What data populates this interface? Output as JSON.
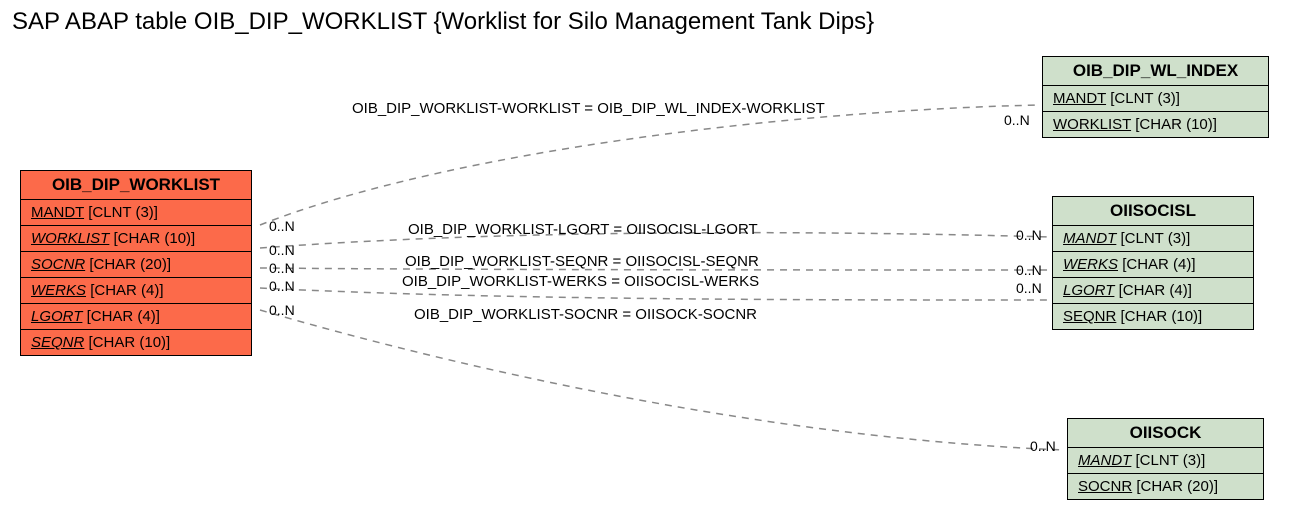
{
  "title": "SAP ABAP table OIB_DIP_WORKLIST {Worklist for Silo Management Tank Dips}",
  "entities": {
    "main": {
      "name": "OIB_DIP_WORKLIST",
      "fields": [
        {
          "name": "MANDT",
          "type": "[CLNT (3)]",
          "key": false
        },
        {
          "name": "WORKLIST",
          "type": "[CHAR (10)]",
          "key": true
        },
        {
          "name": "SOCNR",
          "type": "[CHAR (20)]",
          "key": true
        },
        {
          "name": "WERKS",
          "type": "[CHAR (4)]",
          "key": true
        },
        {
          "name": "LGORT",
          "type": "[CHAR (4)]",
          "key": true
        },
        {
          "name": "SEQNR",
          "type": "[CHAR (10)]",
          "key": true
        }
      ]
    },
    "wlindex": {
      "name": "OIB_DIP_WL_INDEX",
      "fields": [
        {
          "name": "MANDT",
          "type": "[CLNT (3)]",
          "key": false
        },
        {
          "name": "WORKLIST",
          "type": "[CHAR (10)]",
          "key": false
        }
      ]
    },
    "oiisocisl": {
      "name": "OIISOCISL",
      "fields": [
        {
          "name": "MANDT",
          "type": "[CLNT (3)]",
          "key": true
        },
        {
          "name": "WERKS",
          "type": "[CHAR (4)]",
          "key": true
        },
        {
          "name": "LGORT",
          "type": "[CHAR (4)]",
          "key": true
        },
        {
          "name": "SEQNR",
          "type": "[CHAR (10)]",
          "key": false
        }
      ]
    },
    "oiisock": {
      "name": "OIISOCK",
      "fields": [
        {
          "name": "MANDT",
          "type": "[CLNT (3)]",
          "key": true
        },
        {
          "name": "SOCNR",
          "type": "[CHAR (20)]",
          "key": false
        }
      ]
    }
  },
  "relations": {
    "r1": "OIB_DIP_WORKLIST-WORKLIST = OIB_DIP_WL_INDEX-WORKLIST",
    "r2": "OIB_DIP_WORKLIST-LGORT = OIISOCISL-LGORT",
    "r3": "OIB_DIP_WORKLIST-SEQNR = OIISOCISL-SEQNR",
    "r4": "OIB_DIP_WORKLIST-WERKS = OIISOCISL-WERKS",
    "r5": "OIB_DIP_WORKLIST-SOCNR = OIISOCK-SOCNR"
  },
  "cardinality": "0..N"
}
